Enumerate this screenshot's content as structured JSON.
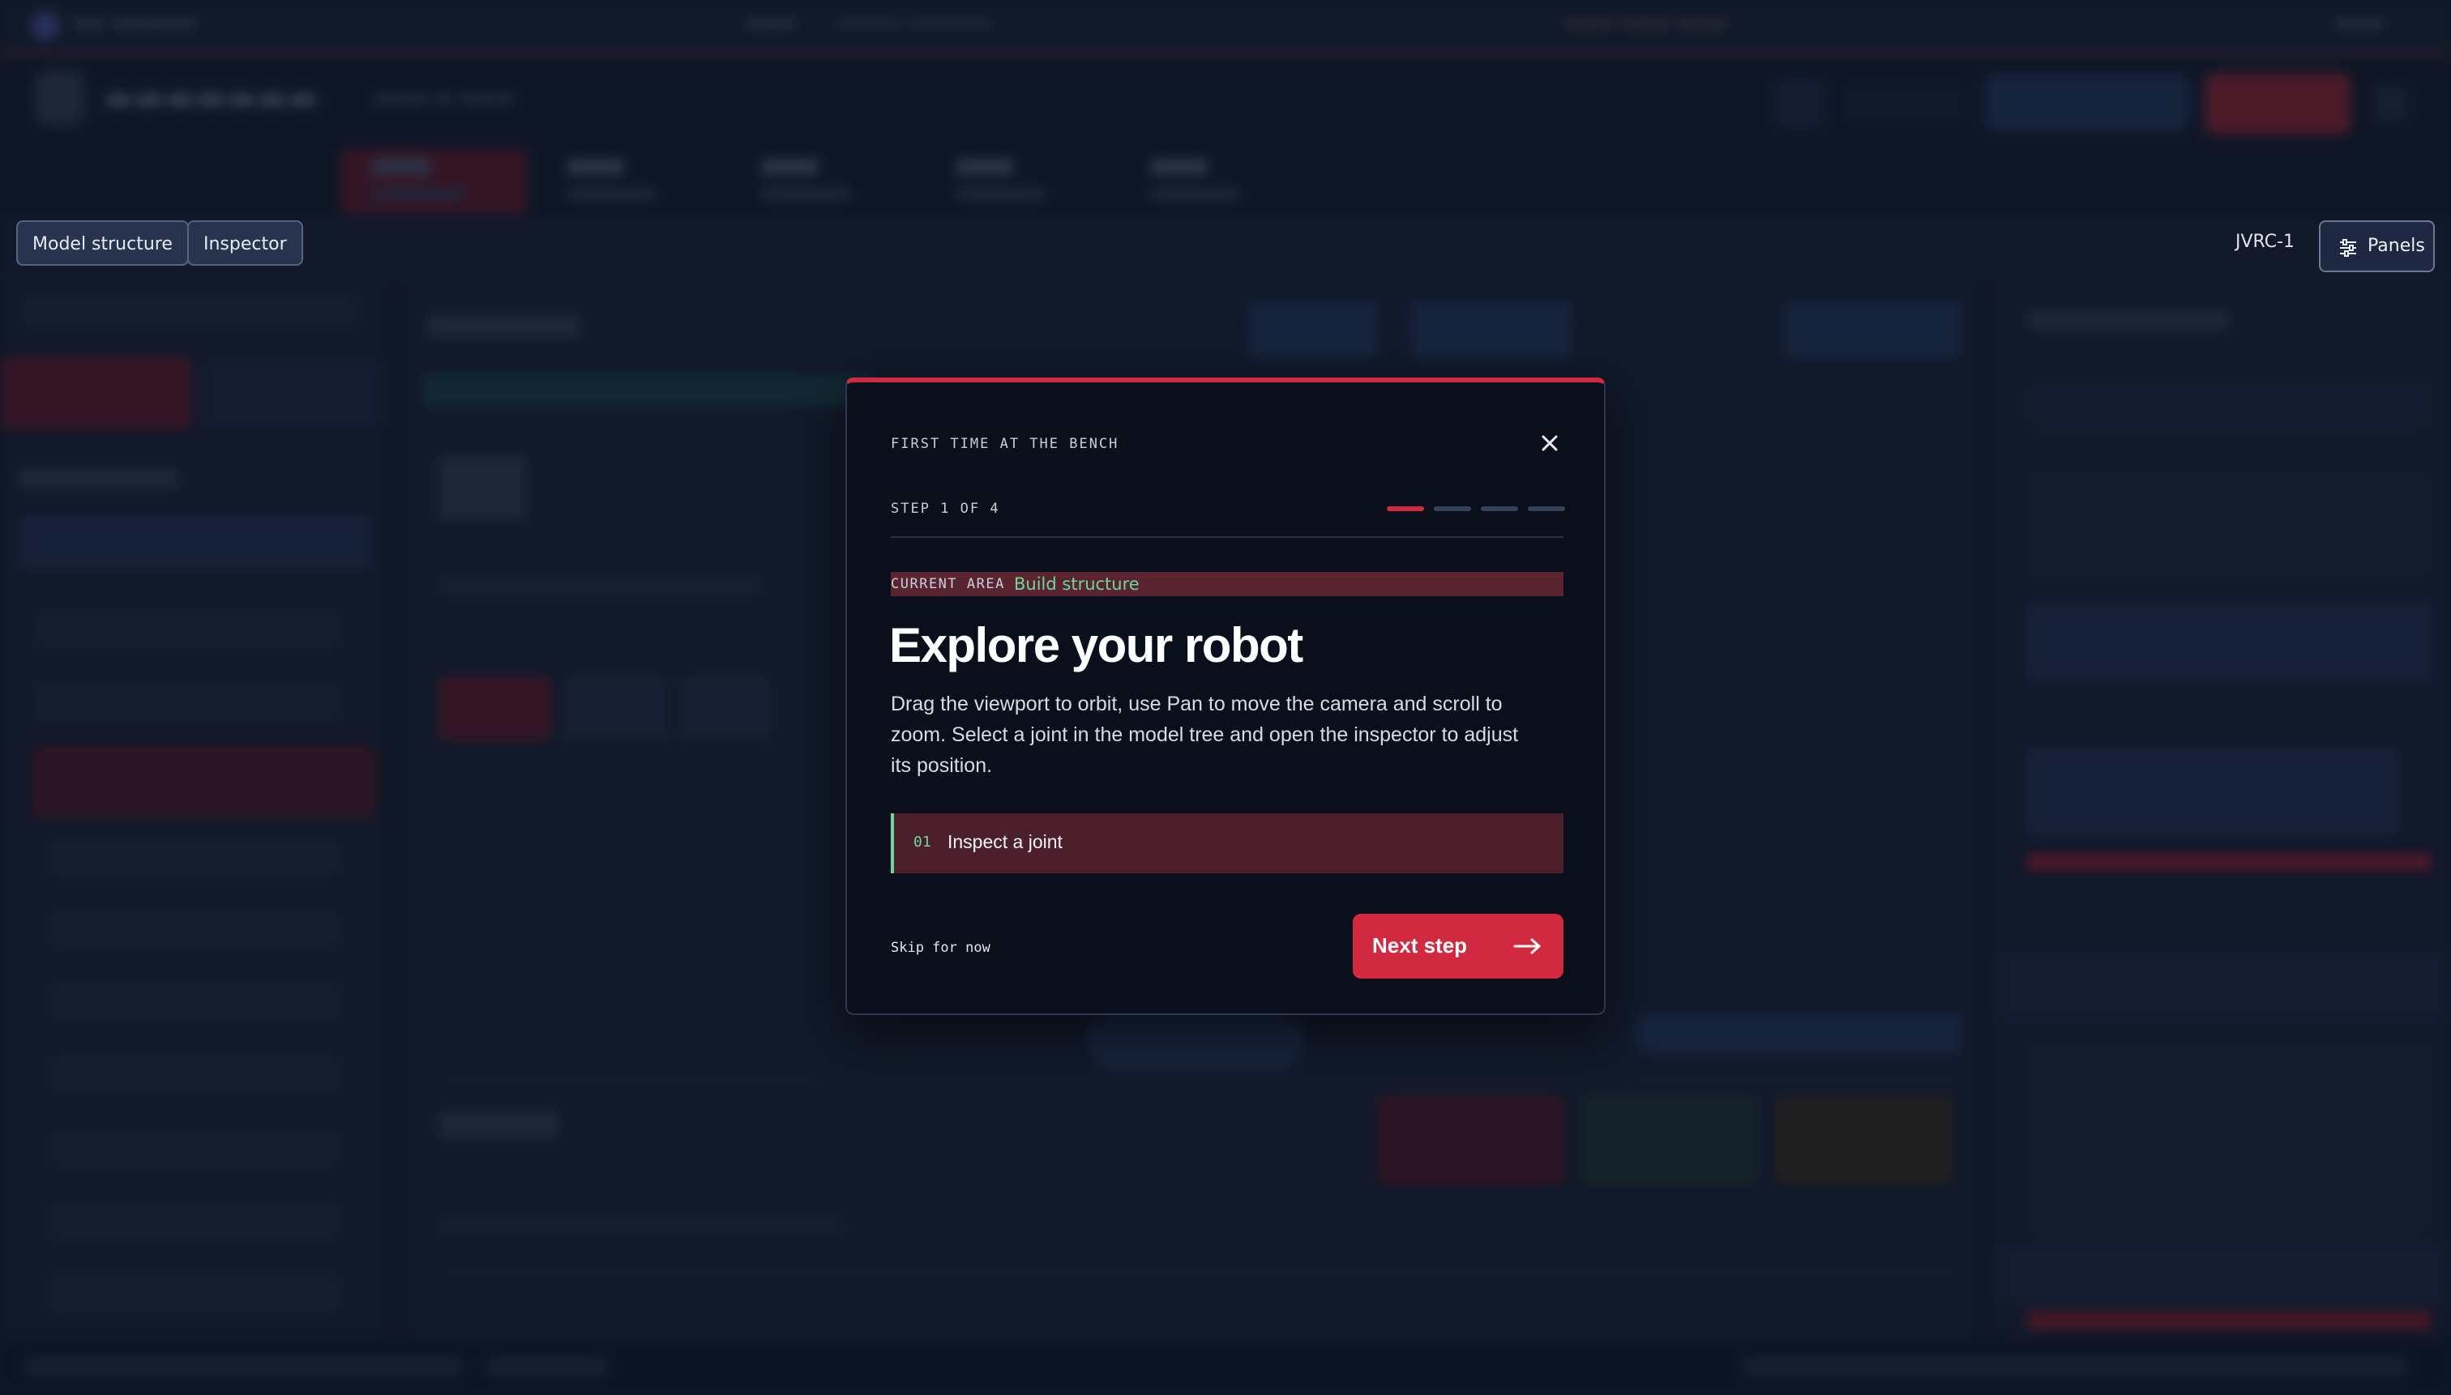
{
  "toolbar": {
    "model_structure_label": "Model structure",
    "inspector_label": "Inspector",
    "robot_name": "JVRC-1",
    "panels_label": "Panels"
  },
  "modal": {
    "kicker": "FIRST TIME AT THE BENCH",
    "step_text": "STEP 1 OF 4",
    "step_current": 1,
    "step_total": 4,
    "current_area_label": "CURRENT AREA",
    "current_area_value": "Build structure",
    "title": "Explore your robot",
    "body": "Drag the viewport to orbit, use Pan to move the camera and scroll to zoom. Select a joint in the model tree and open the inspector to adjust its position.",
    "task_number": "01",
    "task_label": "Inspect a joint",
    "skip_label": "Skip for now",
    "next_label": "Next step"
  },
  "colors": {
    "accent": "#d1293f",
    "success": "#6fd69a",
    "modal_bg": "#0b0f1b",
    "page_bg": "#1b2438",
    "step_inactive": "#33415a"
  },
  "icons": {
    "close": "close-icon",
    "panels": "sliders-icon",
    "next": "arrow-right-icon"
  }
}
